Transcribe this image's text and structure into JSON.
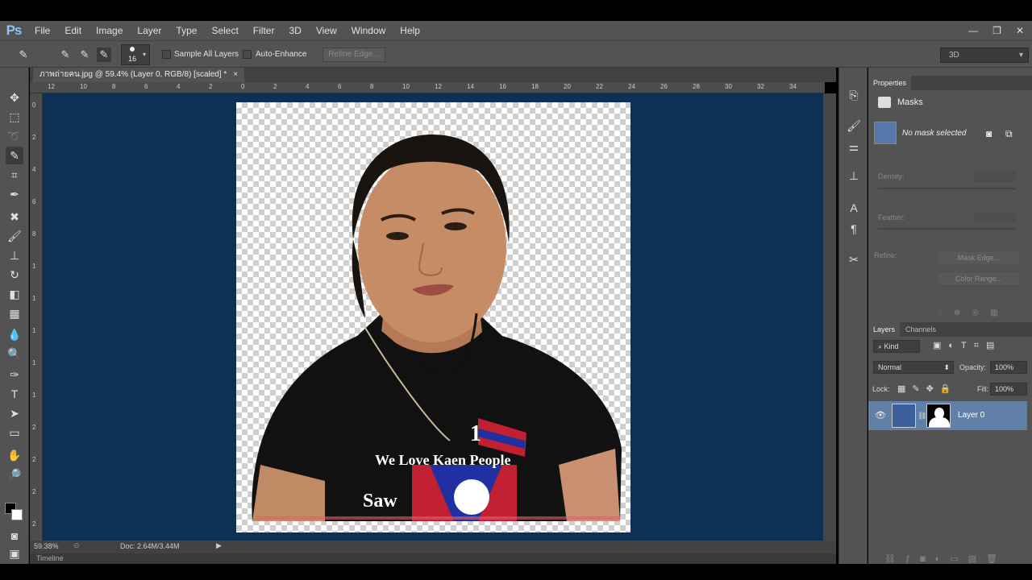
{
  "app": {
    "logo": "Ps"
  },
  "menu": [
    "File",
    "Edit",
    "Image",
    "Layer",
    "Type",
    "Select",
    "Filter",
    "3D",
    "View",
    "Window",
    "Help"
  ],
  "window_controls": {
    "minimize": "—",
    "restore": "❐",
    "close": "✕"
  },
  "options_bar": {
    "brush_size": "16",
    "sample_all_layers": "Sample All Layers",
    "auto_enhance": "Auto-Enhance",
    "refine_edge": "Refine Edge...",
    "workspace": "3D"
  },
  "document": {
    "tab_title": "ภาพถ่ายคน.jpg @ 59.4% (Layer 0, RGB/8) [scaled] *",
    "tab_close": "×",
    "ruler_top": [
      "12",
      "10",
      "8",
      "6",
      "4",
      "2",
      "0",
      "2",
      "4",
      "6",
      "8",
      "10",
      "12",
      "14",
      "16",
      "18",
      "20",
      "22",
      "24",
      "26",
      "28",
      "30",
      "32",
      "34"
    ],
    "ruler_left": [
      "0",
      "2",
      "4",
      "6",
      "8",
      "1",
      "1",
      "1",
      "1",
      "1",
      "2",
      "2",
      "2",
      "2"
    ],
    "image_text": {
      "line1": "We Love Kaen People",
      "line2": "Saw",
      "badge": "1"
    }
  },
  "status": {
    "zoom": "59.38%",
    "doc_size": "Doc: 2.64M/3.44M"
  },
  "timeline": {
    "label": "Timeline"
  },
  "properties": {
    "tab": "Properties",
    "section": "Masks",
    "mask_status": "No mask selected",
    "density": "Density:",
    "feather": "Feather:",
    "refine": "Refine:",
    "mask_edge": "Mask Edge...",
    "color_range": "Color Range..."
  },
  "layers_panel": {
    "tabs": [
      "Layers",
      "Channels"
    ],
    "filter_kind": "Kind",
    "blend_mode": "Normal",
    "opacity_label": "Opacity:",
    "opacity_value": "100%",
    "lock_label": "Lock:",
    "fill_label": "Fill:",
    "fill_value": "100%",
    "layers": [
      {
        "name": "Layer 0",
        "visible": true
      }
    ]
  },
  "colors": {
    "chrome": "#535353",
    "canvas": "#0d3055",
    "layer_selected": "#6080a8"
  }
}
